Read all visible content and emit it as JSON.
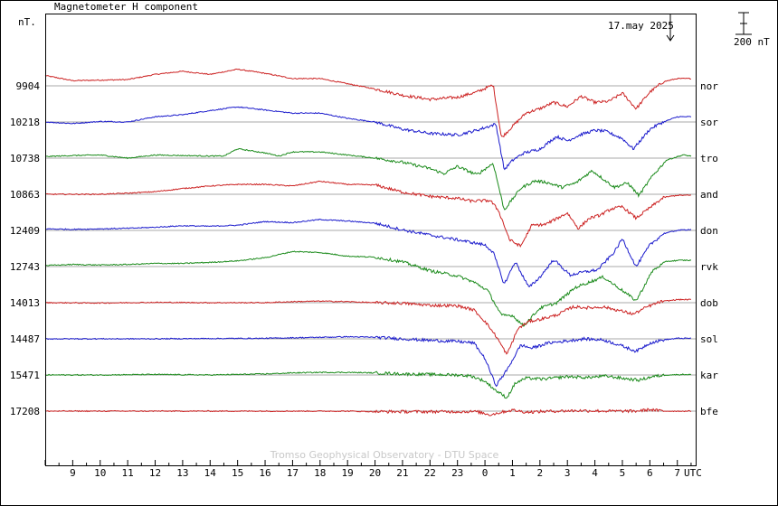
{
  "chart_data": {
    "type": "line",
    "title": "Magnetometer H component",
    "ylabel": "nT.",
    "xlabel": "UTC",
    "date_label": "17.may 2025",
    "scale_label": "200 nT",
    "scale_nT": 200,
    "footer": "Tromso Geophysical Observatory - DTU Space",
    "x_ticks": [
      "9",
      "10",
      "11",
      "12",
      "13",
      "14",
      "15",
      "16",
      "17",
      "18",
      "19",
      "20",
      "21",
      "22",
      "23",
      "0",
      "1",
      "2",
      "3",
      "4",
      "5",
      "6",
      "7"
    ],
    "x_range": [
      8.0,
      31.7
    ],
    "grid": "horizontal baselines only",
    "series": [
      {
        "name": "nor",
        "baseline": 9904,
        "color": "#cc2222",
        "points": [
          [
            8,
            99
          ],
          [
            9,
            50
          ],
          [
            11,
            60
          ],
          [
            12,
            110
          ],
          [
            13,
            140
          ],
          [
            14,
            110
          ],
          [
            15,
            160
          ],
          [
            16,
            120
          ],
          [
            17,
            70
          ],
          [
            18,
            70
          ],
          [
            19,
            20
          ],
          [
            20,
            -30
          ],
          [
            21,
            -90
          ],
          [
            22,
            -130
          ],
          [
            23,
            -110
          ],
          [
            23.7,
            -60
          ],
          [
            24.3,
            10
          ],
          [
            24.6,
            -500
          ],
          [
            25,
            -390
          ],
          [
            25.5,
            -260
          ],
          [
            26,
            -220
          ],
          [
            26.5,
            -160
          ],
          [
            27,
            -200
          ],
          [
            27.5,
            -100
          ],
          [
            28,
            -160
          ],
          [
            28.5,
            -150
          ],
          [
            29,
            -70
          ],
          [
            29.5,
            -220
          ],
          [
            30,
            -60
          ],
          [
            30.5,
            40
          ],
          [
            31,
            70
          ],
          [
            31.5,
            70
          ]
        ]
      },
      {
        "name": "sor",
        "baseline": 10218,
        "color": "#1a1acc",
        "points": [
          [
            8,
            0
          ],
          [
            9,
            -15
          ],
          [
            10,
            5
          ],
          [
            11,
            0
          ],
          [
            12,
            50
          ],
          [
            13,
            70
          ],
          [
            14,
            110
          ],
          [
            15,
            145
          ],
          [
            16,
            115
          ],
          [
            17,
            85
          ],
          [
            18,
            85
          ],
          [
            19,
            35
          ],
          [
            20,
            0
          ],
          [
            21,
            -70
          ],
          [
            22,
            -110
          ],
          [
            23,
            -125
          ],
          [
            23.7,
            -80
          ],
          [
            24.4,
            -20
          ],
          [
            24.7,
            -460
          ],
          [
            25,
            -370
          ],
          [
            25.4,
            -300
          ],
          [
            26,
            -260
          ],
          [
            26.6,
            -140
          ],
          [
            27,
            -180
          ],
          [
            27.5,
            -120
          ],
          [
            28,
            -80
          ],
          [
            28.4,
            -90
          ],
          [
            29,
            -160
          ],
          [
            29.4,
            -260
          ],
          [
            30,
            -70
          ],
          [
            30.4,
            -10
          ],
          [
            31,
            50
          ],
          [
            31.5,
            50
          ]
        ]
      },
      {
        "name": "tro",
        "baseline": 10738,
        "color": "#1a8a1a",
        "points": [
          [
            8,
            15
          ],
          [
            9,
            25
          ],
          [
            10,
            30
          ],
          [
            11,
            0
          ],
          [
            12,
            30
          ],
          [
            13,
            25
          ],
          [
            14,
            20
          ],
          [
            14.5,
            20
          ],
          [
            15,
            90
          ],
          [
            16,
            50
          ],
          [
            16.5,
            20
          ],
          [
            17,
            60
          ],
          [
            18,
            60
          ],
          [
            19,
            30
          ],
          [
            20,
            0
          ],
          [
            21,
            -40
          ],
          [
            22,
            -100
          ],
          [
            22.5,
            -150
          ],
          [
            23,
            -80
          ],
          [
            23.7,
            -160
          ],
          [
            24.3,
            -50
          ],
          [
            24.7,
            -500
          ],
          [
            25.3,
            -290
          ],
          [
            25.8,
            -220
          ],
          [
            26.2,
            -230
          ],
          [
            26.8,
            -280
          ],
          [
            27.3,
            -240
          ],
          [
            27.9,
            -120
          ],
          [
            28.3,
            -200
          ],
          [
            28.7,
            -280
          ],
          [
            29.2,
            -240
          ],
          [
            29.6,
            -360
          ],
          [
            30.1,
            -170
          ],
          [
            30.6,
            -20
          ],
          [
            31.2,
            30
          ],
          [
            31.5,
            20
          ]
        ]
      },
      {
        "name": "and",
        "baseline": 10863,
        "color": "#cc2222",
        "points": [
          [
            8,
            0
          ],
          [
            9,
            0
          ],
          [
            10,
            0
          ],
          [
            11,
            10
          ],
          [
            12,
            25
          ],
          [
            13,
            55
          ],
          [
            14,
            80
          ],
          [
            15,
            95
          ],
          [
            16,
            95
          ],
          [
            17,
            80
          ],
          [
            18,
            125
          ],
          [
            19,
            95
          ],
          [
            20,
            90
          ],
          [
            21,
            20
          ],
          [
            22,
            -20
          ],
          [
            23,
            -40
          ],
          [
            23.5,
            -65
          ],
          [
            24.2,
            -60
          ],
          [
            24.5,
            -160
          ],
          [
            24.9,
            -440
          ],
          [
            25.3,
            -500
          ],
          [
            25.7,
            -300
          ],
          [
            26.2,
            -290
          ],
          [
            27,
            -180
          ],
          [
            27.4,
            -330
          ],
          [
            27.8,
            -230
          ],
          [
            28.2,
            -200
          ],
          [
            28.6,
            -140
          ],
          [
            29,
            -120
          ],
          [
            29.5,
            -230
          ],
          [
            30,
            -130
          ],
          [
            30.5,
            -30
          ],
          [
            31,
            -10
          ],
          [
            31.5,
            -10
          ]
        ]
      },
      {
        "name": "don",
        "baseline": 12409,
        "color": "#1a1acc",
        "points": [
          [
            8,
            15
          ],
          [
            9,
            10
          ],
          [
            10,
            15
          ],
          [
            11,
            20
          ],
          [
            12,
            30
          ],
          [
            13,
            45
          ],
          [
            14,
            40
          ],
          [
            15,
            50
          ],
          [
            16,
            85
          ],
          [
            17,
            75
          ],
          [
            18,
            105
          ],
          [
            19,
            90
          ],
          [
            20,
            70
          ],
          [
            21,
            5
          ],
          [
            22,
            -45
          ],
          [
            23,
            -90
          ],
          [
            24,
            -140
          ],
          [
            24.3,
            -210
          ],
          [
            24.7,
            -520
          ],
          [
            25.1,
            -300
          ],
          [
            25.6,
            -550
          ],
          [
            26,
            -450
          ],
          [
            26.5,
            -280
          ],
          [
            27.1,
            -430
          ],
          [
            27.6,
            -400
          ],
          [
            28.1,
            -380
          ],
          [
            28.7,
            -210
          ],
          [
            29,
            -80
          ],
          [
            29.5,
            -350
          ],
          [
            30,
            -140
          ],
          [
            30.5,
            -30
          ],
          [
            31,
            0
          ],
          [
            31.5,
            10
          ]
        ]
      },
      {
        "name": "rvk",
        "baseline": 12743,
        "color": "#1a8a1a",
        "points": [
          [
            8,
            10
          ],
          [
            9,
            20
          ],
          [
            10,
            15
          ],
          [
            11,
            20
          ],
          [
            12,
            30
          ],
          [
            13,
            30
          ],
          [
            14,
            40
          ],
          [
            15,
            55
          ],
          [
            16,
            85
          ],
          [
            17,
            145
          ],
          [
            18,
            135
          ],
          [
            19,
            100
          ],
          [
            20,
            90
          ],
          [
            21,
            45
          ],
          [
            22,
            -40
          ],
          [
            23,
            -90
          ],
          [
            23.6,
            -150
          ],
          [
            24.1,
            -230
          ],
          [
            24.6,
            -470
          ],
          [
            25,
            -470
          ],
          [
            25.4,
            -570
          ],
          [
            26,
            -400
          ],
          [
            26.6,
            -350
          ],
          [
            27.3,
            -200
          ],
          [
            27.8,
            -150
          ],
          [
            28.3,
            -100
          ],
          [
            29,
            -230
          ],
          [
            29.5,
            -330
          ],
          [
            30.1,
            -40
          ],
          [
            30.6,
            50
          ],
          [
            31.1,
            60
          ],
          [
            31.5,
            60
          ]
        ]
      },
      {
        "name": "dob",
        "baseline": 14013,
        "color": "#cc2222",
        "points": [
          [
            8,
            0
          ],
          [
            10,
            -3
          ],
          [
            12,
            3
          ],
          [
            14,
            0
          ],
          [
            16,
            0
          ],
          [
            17,
            10
          ],
          [
            18,
            15
          ],
          [
            19,
            10
          ],
          [
            20,
            0
          ],
          [
            21,
            -5
          ],
          [
            22,
            -25
          ],
          [
            23,
            -30
          ],
          [
            23.6,
            -70
          ],
          [
            24,
            -180
          ],
          [
            24.4,
            -320
          ],
          [
            24.8,
            -500
          ],
          [
            25.2,
            -250
          ],
          [
            25.6,
            -180
          ],
          [
            26,
            -160
          ],
          [
            26.6,
            -120
          ],
          [
            27.2,
            -40
          ],
          [
            27.8,
            -50
          ],
          [
            28.3,
            -40
          ],
          [
            28.8,
            -70
          ],
          [
            29.4,
            -110
          ],
          [
            29.9,
            -40
          ],
          [
            30.4,
            10
          ],
          [
            31,
            30
          ],
          [
            31.5,
            30
          ]
        ]
      },
      {
        "name": "sol",
        "baseline": 14487,
        "color": "#1a1acc",
        "points": [
          [
            8,
            0
          ],
          [
            10,
            0
          ],
          [
            12,
            0
          ],
          [
            14,
            3
          ],
          [
            16,
            5
          ],
          [
            18,
            15
          ],
          [
            19,
            20
          ],
          [
            20,
            15
          ],
          [
            21,
            0
          ],
          [
            22,
            -15
          ],
          [
            23,
            -25
          ],
          [
            23.6,
            -40
          ],
          [
            24,
            -190
          ],
          [
            24.4,
            -450
          ],
          [
            24.8,
            -300
          ],
          [
            25.3,
            -60
          ],
          [
            25.7,
            -90
          ],
          [
            26.3,
            -40
          ],
          [
            27,
            -20
          ],
          [
            27.6,
            0
          ],
          [
            28.3,
            -10
          ],
          [
            28.9,
            -60
          ],
          [
            29.5,
            -120
          ],
          [
            30,
            -40
          ],
          [
            30.5,
            -10
          ],
          [
            31,
            5
          ],
          [
            31.5,
            5
          ]
        ]
      },
      {
        "name": "kar",
        "baseline": 15471,
        "color": "#1a8a1a",
        "points": [
          [
            8,
            0
          ],
          [
            10,
            0
          ],
          [
            12,
            5
          ],
          [
            14,
            0
          ],
          [
            16,
            10
          ],
          [
            17,
            20
          ],
          [
            18,
            25
          ],
          [
            19,
            25
          ],
          [
            20,
            20
          ],
          [
            21,
            10
          ],
          [
            22,
            5
          ],
          [
            23,
            0
          ],
          [
            23.5,
            -10
          ],
          [
            24,
            -60
          ],
          [
            24.4,
            -150
          ],
          [
            24.8,
            -220
          ],
          [
            25.1,
            -80
          ],
          [
            25.5,
            -30
          ],
          [
            26.1,
            -40
          ],
          [
            27,
            -15
          ],
          [
            27.7,
            -25
          ],
          [
            28.4,
            -10
          ],
          [
            29.1,
            -35
          ],
          [
            29.6,
            -50
          ],
          [
            30.1,
            -15
          ],
          [
            30.6,
            0
          ],
          [
            31.2,
            5
          ],
          [
            31.5,
            5
          ]
        ]
      },
      {
        "name": "bfe",
        "baseline": 17208,
        "color": "#cc2222",
        "points": [
          [
            8,
            0
          ],
          [
            10,
            0
          ],
          [
            12,
            0
          ],
          [
            14,
            0
          ],
          [
            16,
            0
          ],
          [
            18,
            0
          ],
          [
            19,
            0
          ],
          [
            20,
            -5
          ],
          [
            21,
            -5
          ],
          [
            22,
            -5
          ],
          [
            23,
            -5
          ],
          [
            23.7,
            -5
          ],
          [
            24.2,
            -35
          ],
          [
            24.6,
            -10
          ],
          [
            25,
            10
          ],
          [
            25.5,
            -10
          ],
          [
            26.5,
            0
          ],
          [
            27.5,
            5
          ],
          [
            28.5,
            0
          ],
          [
            29.5,
            0
          ],
          [
            30,
            15
          ],
          [
            30.5,
            0
          ],
          [
            31.5,
            0
          ]
        ]
      }
    ]
  }
}
